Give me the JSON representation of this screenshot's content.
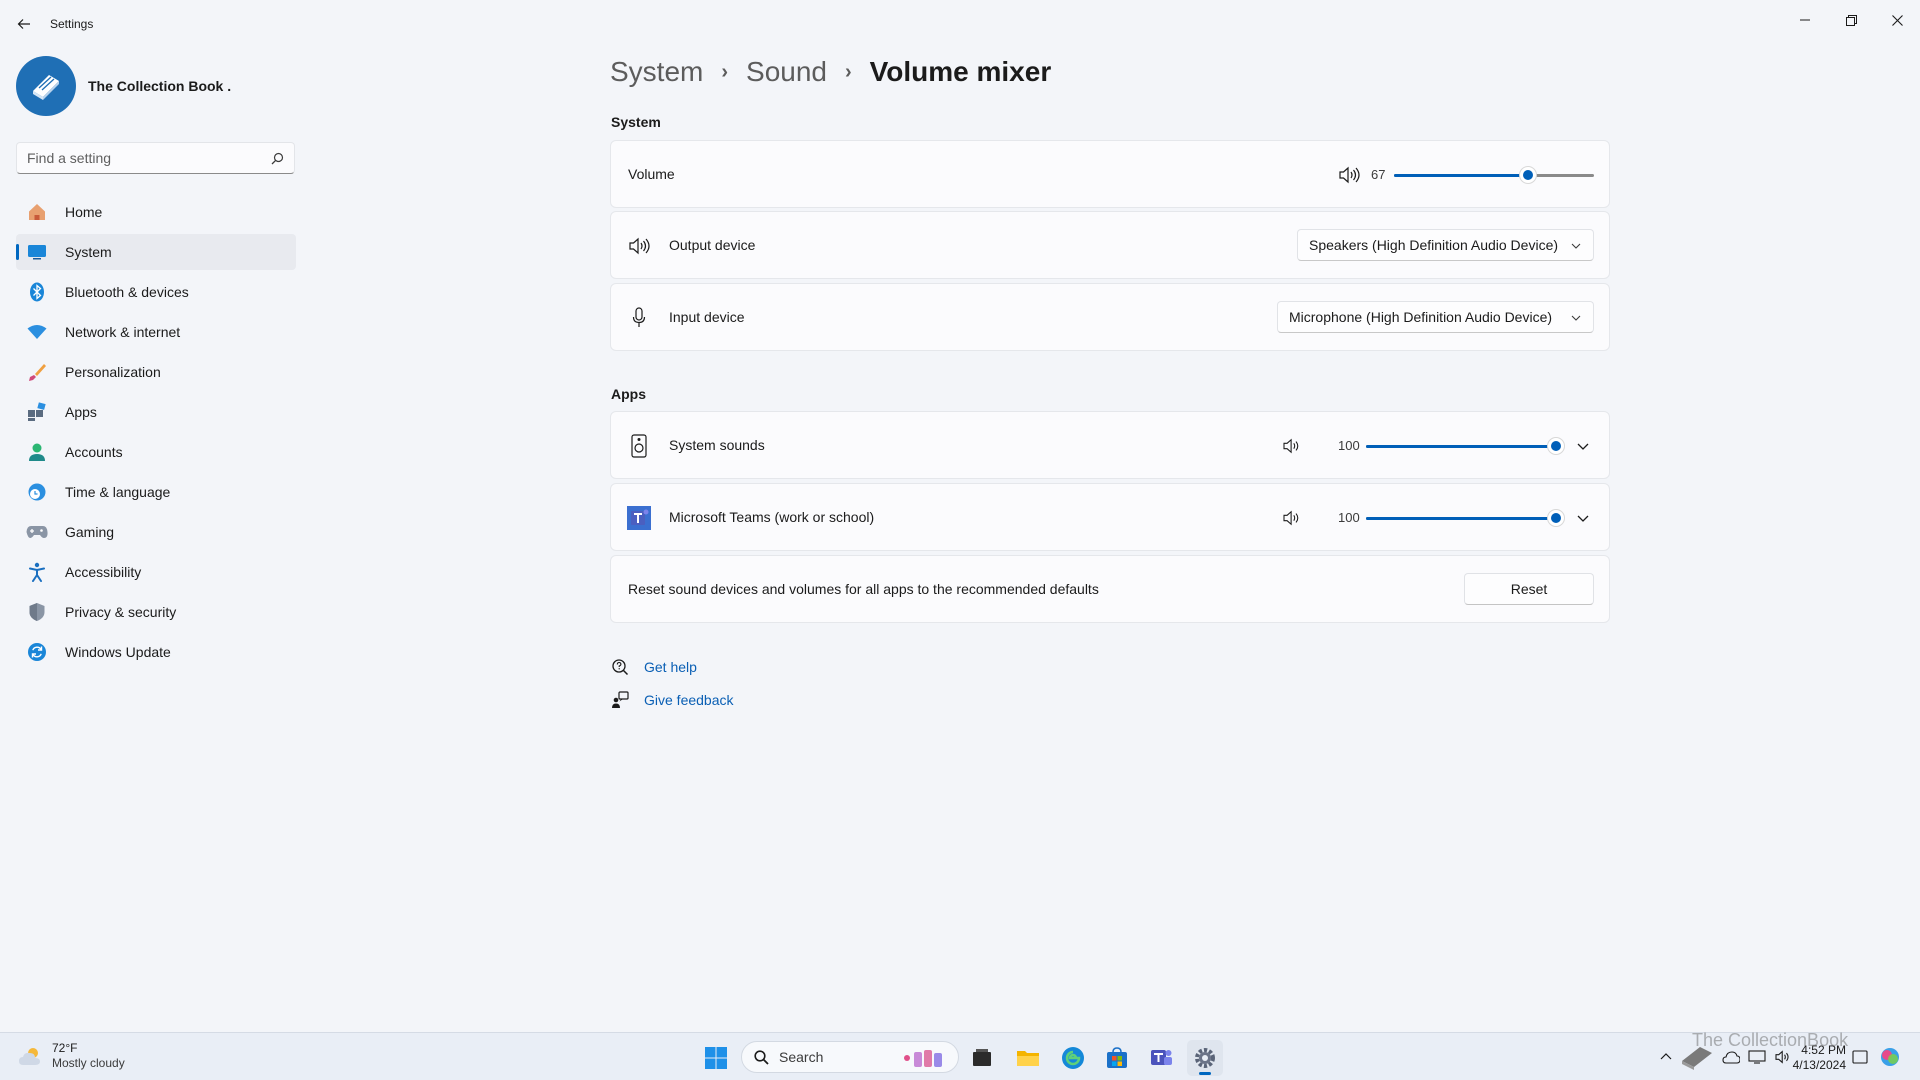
{
  "window": {
    "app_title": "Settings"
  },
  "profile": {
    "name": "The Collection Book ."
  },
  "search": {
    "placeholder": "Find a setting"
  },
  "sidebar": {
    "items": [
      {
        "label": "Home",
        "icon": "home-icon"
      },
      {
        "label": "System",
        "icon": "system-icon",
        "active": true
      },
      {
        "label": "Bluetooth & devices",
        "icon": "bluetooth-icon"
      },
      {
        "label": "Network & internet",
        "icon": "wifi-icon"
      },
      {
        "label": "Personalization",
        "icon": "brush-icon"
      },
      {
        "label": "Apps",
        "icon": "apps-icon"
      },
      {
        "label": "Accounts",
        "icon": "person-icon"
      },
      {
        "label": "Time & language",
        "icon": "clock-globe-icon"
      },
      {
        "label": "Gaming",
        "icon": "gamepad-icon"
      },
      {
        "label": "Accessibility",
        "icon": "accessibility-icon"
      },
      {
        "label": "Privacy & security",
        "icon": "shield-icon"
      },
      {
        "label": "Windows Update",
        "icon": "update-icon"
      }
    ]
  },
  "breadcrumb": {
    "level1": "System",
    "level2": "Sound",
    "current": "Volume mixer",
    "separator": "›"
  },
  "system_section": {
    "heading": "System",
    "volume": {
      "label": "Volume",
      "value": 67,
      "display": "67"
    },
    "output": {
      "label": "Output device",
      "selected": "Speakers (High Definition Audio Device)"
    },
    "input": {
      "label": "Input device",
      "selected": "Microphone (High Definition Audio Device)"
    }
  },
  "apps_section": {
    "heading": "Apps",
    "apps": [
      {
        "name": "System sounds",
        "icon": "speaker-device-icon",
        "volume": 100,
        "display": "100"
      },
      {
        "name": "Microsoft Teams (work or school)",
        "icon": "teams-icon",
        "volume": 100,
        "display": "100"
      }
    ],
    "reset": {
      "text": "Reset sound devices and volumes for all apps to the recommended defaults",
      "button": "Reset"
    }
  },
  "help": {
    "get_help": "Get help",
    "give_feedback": "Give feedback"
  },
  "taskbar": {
    "weather": {
      "temp": "72°F",
      "condition": "Mostly cloudy"
    },
    "search_label": "Search",
    "clock": {
      "time": "4:52 PM",
      "date": "4/13/2024"
    },
    "apps": [
      "start-icon",
      "search-icon",
      "task-view-icon",
      "file-explorer-icon",
      "edge-icon",
      "store-icon",
      "teams-icon",
      "settings-icon"
    ]
  },
  "watermark": "The CollectionBook",
  "colors": {
    "accent": "#005fb8",
    "link": "#0a5fb4",
    "background": "#f3f5f9",
    "card": "#fbfbfd"
  }
}
